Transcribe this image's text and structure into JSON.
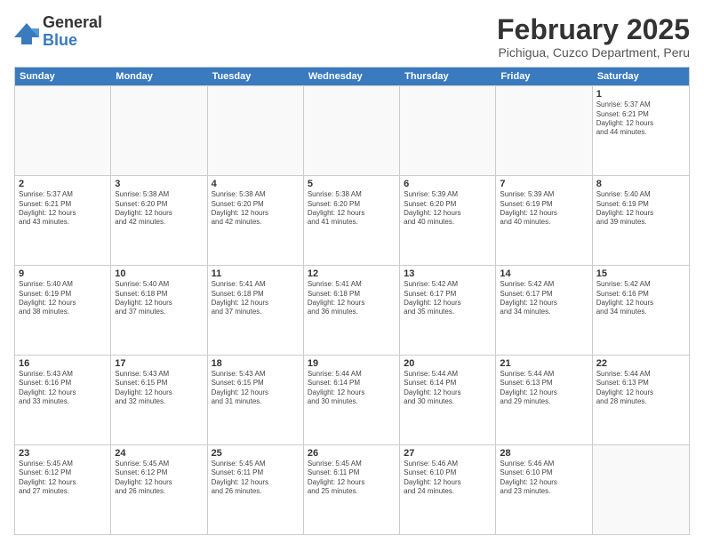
{
  "logo": {
    "general": "General",
    "blue": "Blue"
  },
  "header": {
    "month": "February 2025",
    "location": "Pichigua, Cuzco Department, Peru"
  },
  "weekdays": [
    "Sunday",
    "Monday",
    "Tuesday",
    "Wednesday",
    "Thursday",
    "Friday",
    "Saturday"
  ],
  "weeks": [
    [
      {
        "day": "",
        "info": ""
      },
      {
        "day": "",
        "info": ""
      },
      {
        "day": "",
        "info": ""
      },
      {
        "day": "",
        "info": ""
      },
      {
        "day": "",
        "info": ""
      },
      {
        "day": "",
        "info": ""
      },
      {
        "day": "1",
        "info": "Sunrise: 5:37 AM\nSunset: 6:21 PM\nDaylight: 12 hours\nand 44 minutes."
      }
    ],
    [
      {
        "day": "2",
        "info": "Sunrise: 5:37 AM\nSunset: 6:21 PM\nDaylight: 12 hours\nand 43 minutes."
      },
      {
        "day": "3",
        "info": "Sunrise: 5:38 AM\nSunset: 6:20 PM\nDaylight: 12 hours\nand 42 minutes."
      },
      {
        "day": "4",
        "info": "Sunrise: 5:38 AM\nSunset: 6:20 PM\nDaylight: 12 hours\nand 42 minutes."
      },
      {
        "day": "5",
        "info": "Sunrise: 5:38 AM\nSunset: 6:20 PM\nDaylight: 12 hours\nand 41 minutes."
      },
      {
        "day": "6",
        "info": "Sunrise: 5:39 AM\nSunset: 6:20 PM\nDaylight: 12 hours\nand 40 minutes."
      },
      {
        "day": "7",
        "info": "Sunrise: 5:39 AM\nSunset: 6:19 PM\nDaylight: 12 hours\nand 40 minutes."
      },
      {
        "day": "8",
        "info": "Sunrise: 5:40 AM\nSunset: 6:19 PM\nDaylight: 12 hours\nand 39 minutes."
      }
    ],
    [
      {
        "day": "9",
        "info": "Sunrise: 5:40 AM\nSunset: 6:19 PM\nDaylight: 12 hours\nand 38 minutes."
      },
      {
        "day": "10",
        "info": "Sunrise: 5:40 AM\nSunset: 6:18 PM\nDaylight: 12 hours\nand 37 minutes."
      },
      {
        "day": "11",
        "info": "Sunrise: 5:41 AM\nSunset: 6:18 PM\nDaylight: 12 hours\nand 37 minutes."
      },
      {
        "day": "12",
        "info": "Sunrise: 5:41 AM\nSunset: 6:18 PM\nDaylight: 12 hours\nand 36 minutes."
      },
      {
        "day": "13",
        "info": "Sunrise: 5:42 AM\nSunset: 6:17 PM\nDaylight: 12 hours\nand 35 minutes."
      },
      {
        "day": "14",
        "info": "Sunrise: 5:42 AM\nSunset: 6:17 PM\nDaylight: 12 hours\nand 34 minutes."
      },
      {
        "day": "15",
        "info": "Sunrise: 5:42 AM\nSunset: 6:16 PM\nDaylight: 12 hours\nand 34 minutes."
      }
    ],
    [
      {
        "day": "16",
        "info": "Sunrise: 5:43 AM\nSunset: 6:16 PM\nDaylight: 12 hours\nand 33 minutes."
      },
      {
        "day": "17",
        "info": "Sunrise: 5:43 AM\nSunset: 6:15 PM\nDaylight: 12 hours\nand 32 minutes."
      },
      {
        "day": "18",
        "info": "Sunrise: 5:43 AM\nSunset: 6:15 PM\nDaylight: 12 hours\nand 31 minutes."
      },
      {
        "day": "19",
        "info": "Sunrise: 5:44 AM\nSunset: 6:14 PM\nDaylight: 12 hours\nand 30 minutes."
      },
      {
        "day": "20",
        "info": "Sunrise: 5:44 AM\nSunset: 6:14 PM\nDaylight: 12 hours\nand 30 minutes."
      },
      {
        "day": "21",
        "info": "Sunrise: 5:44 AM\nSunset: 6:13 PM\nDaylight: 12 hours\nand 29 minutes."
      },
      {
        "day": "22",
        "info": "Sunrise: 5:44 AM\nSunset: 6:13 PM\nDaylight: 12 hours\nand 28 minutes."
      }
    ],
    [
      {
        "day": "23",
        "info": "Sunrise: 5:45 AM\nSunset: 6:12 PM\nDaylight: 12 hours\nand 27 minutes."
      },
      {
        "day": "24",
        "info": "Sunrise: 5:45 AM\nSunset: 6:12 PM\nDaylight: 12 hours\nand 26 minutes."
      },
      {
        "day": "25",
        "info": "Sunrise: 5:45 AM\nSunset: 6:11 PM\nDaylight: 12 hours\nand 26 minutes."
      },
      {
        "day": "26",
        "info": "Sunrise: 5:45 AM\nSunset: 6:11 PM\nDaylight: 12 hours\nand 25 minutes."
      },
      {
        "day": "27",
        "info": "Sunrise: 5:46 AM\nSunset: 6:10 PM\nDaylight: 12 hours\nand 24 minutes."
      },
      {
        "day": "28",
        "info": "Sunrise: 5:46 AM\nSunset: 6:10 PM\nDaylight: 12 hours\nand 23 minutes."
      },
      {
        "day": "",
        "info": ""
      }
    ]
  ]
}
